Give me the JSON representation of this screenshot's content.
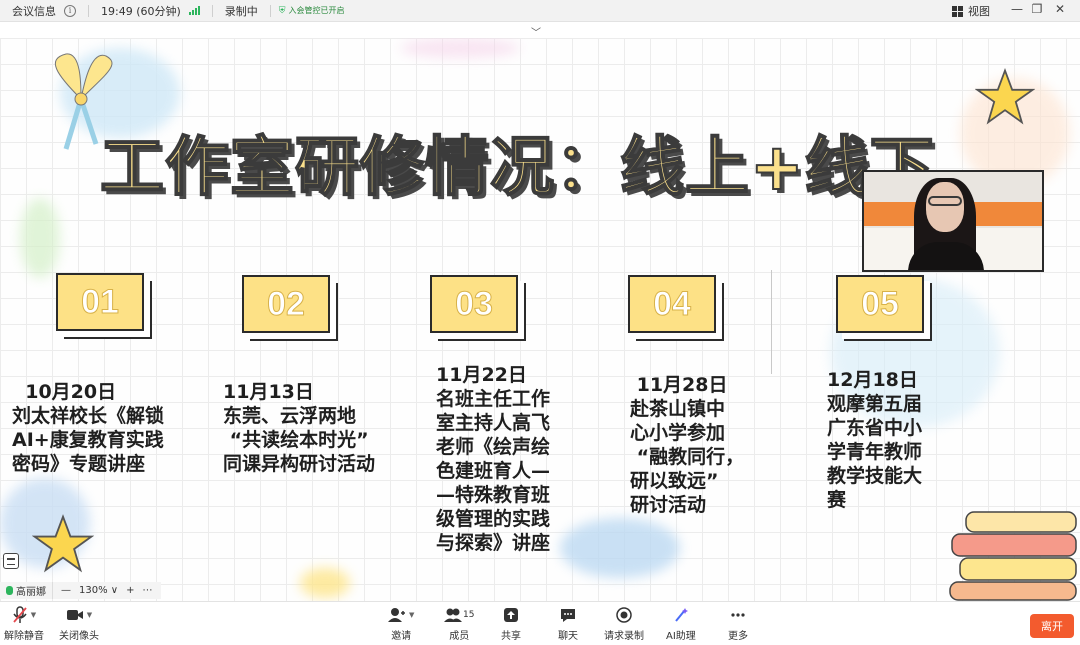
{
  "topbar": {
    "meeting_info": "会议信息",
    "time": "19:49 (60分钟)",
    "recording": "录制中",
    "audit": "入会管控已开启",
    "view": "视图",
    "window_controls": {
      "minimize": "—",
      "restore": "❐",
      "close": "✕"
    },
    "collapse_glyph": "﹀"
  },
  "slide": {
    "title": "工作室研修情况：线上+线下",
    "items": [
      {
        "num": "01",
        "text": "  10月20日\n刘太祥校长《解锁\nAI+康复教育实践\n密码》专题讲座"
      },
      {
        "num": "02",
        "text": "11月13日\n东莞、云浮两地\n “共读绘本时光”\n同课异构研讨活动"
      },
      {
        "num": "03",
        "text": "11月22日\n名班主任工作\n室主持人高飞\n老师《绘声绘\n色建班育人—\n—特殊教育班\n级管理的实践\n与探索》讲座"
      },
      {
        "num": "04",
        "text": " 11月28日\n赴茶山镇中\n心小学参加\n “融教同行，\n研以致远”\n研讨活动"
      },
      {
        "num": "05",
        "text": "12月18日\n观摩第五届\n广东省中小\n学青年教师\n教学技能大\n赛"
      }
    ]
  },
  "status": {
    "participant_name": "高丽娜",
    "zoom_minus": "—",
    "zoom_level": "130%",
    "zoom_caret": "∨",
    "zoom_plus": "+",
    "more": "⋯"
  },
  "toolbar": {
    "items": [
      {
        "label": "解除静音",
        "icon": "mic-muted-icon"
      },
      {
        "label": "关闭像头",
        "icon": "camera-icon"
      },
      {
        "label": "邀请",
        "icon": "invite-user-icon"
      },
      {
        "label": "成员",
        "icon": "members-icon",
        "count": "15"
      },
      {
        "label": "共享",
        "icon": "share-screen-icon"
      },
      {
        "label": "聊天",
        "icon": "chat-icon"
      },
      {
        "label": "请求录制",
        "icon": "record-icon"
      },
      {
        "label": "AI助理",
        "icon": "ai-assistant-icon"
      },
      {
        "label": "更多",
        "icon": "more-icon"
      }
    ],
    "leave": "离开"
  },
  "colors": {
    "leave_button": "#f35b2e",
    "status_green": "#2db55d",
    "title_fill": "#fbe08c",
    "number_box": "#fde186"
  }
}
